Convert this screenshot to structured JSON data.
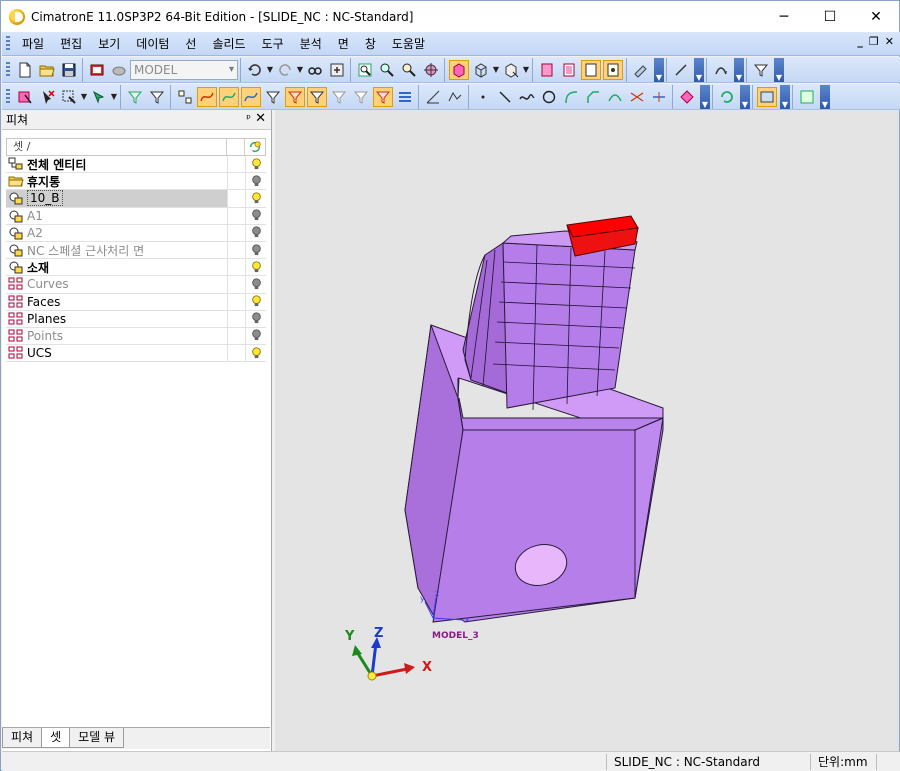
{
  "window": {
    "title": "CimatronE 11.0SP3P2 64-Bit Edition - [SLIDE_NC : NC-Standard]",
    "controls": {
      "minimize": "─",
      "maximize": "☐",
      "close": "✕"
    }
  },
  "menu": {
    "items": [
      "파일",
      "편집",
      "보기",
      "데이텀",
      "선",
      "솔리드",
      "도구",
      "분석",
      "면",
      "창",
      "도움말"
    ],
    "mdi": {
      "minimize": "_",
      "restore": "❐",
      "close": "✕"
    }
  },
  "toolbar": {
    "model_combo": "MODEL"
  },
  "panel": {
    "title": "피쳐",
    "pin": "ᵖ",
    "close": "✕",
    "tree_header": {
      "name_col": "셋 /"
    },
    "rows": [
      {
        "label": "전체 엔티티",
        "icon": "all-entities-icon",
        "bulb": "yellow",
        "style": "bold"
      },
      {
        "label": "휴지통",
        "icon": "trash-folder-icon",
        "bulb": "gray",
        "style": "bold"
      },
      {
        "label": "10_B",
        "icon": "set-icon",
        "bulb": "yellow",
        "style": "selected"
      },
      {
        "label": "A1",
        "icon": "set-icon",
        "bulb": "gray",
        "style": "dim"
      },
      {
        "label": "A2",
        "icon": "set-icon",
        "bulb": "gray",
        "style": "dim"
      },
      {
        "label": "NC 스페셜 근사처리 면",
        "icon": "set-icon",
        "bulb": "gray",
        "style": "dim"
      },
      {
        "label": "소재",
        "icon": "set-icon",
        "bulb": "yellow",
        "style": "bold"
      },
      {
        "label": "Curves",
        "icon": "group-icon",
        "bulb": "gray",
        "style": "dim"
      },
      {
        "label": "Faces",
        "icon": "group-icon",
        "bulb": "yellow",
        "style": "normal"
      },
      {
        "label": "Planes",
        "icon": "group-icon",
        "bulb": "gray",
        "style": "normal"
      },
      {
        "label": "Points",
        "icon": "group-icon",
        "bulb": "gray",
        "style": "dim"
      },
      {
        "label": "UCS",
        "icon": "group-icon",
        "bulb": "yellow",
        "style": "normal"
      }
    ],
    "tabs": [
      "피쳐",
      "셋",
      "모델 뷰"
    ],
    "active_tab": 1
  },
  "viewport": {
    "ucs_label": "MODEL_3",
    "axes": {
      "x": "X",
      "y": "Y",
      "z": "Z"
    },
    "small_axes": {
      "x": "x",
      "y": "y",
      "z": "z"
    },
    "colors": {
      "background": "#e4e4e4",
      "part": "#b97ae8",
      "highlight": "#ff0000"
    }
  },
  "status": {
    "model": "SLIDE_NC : NC-Standard",
    "units": "단위:mm"
  }
}
